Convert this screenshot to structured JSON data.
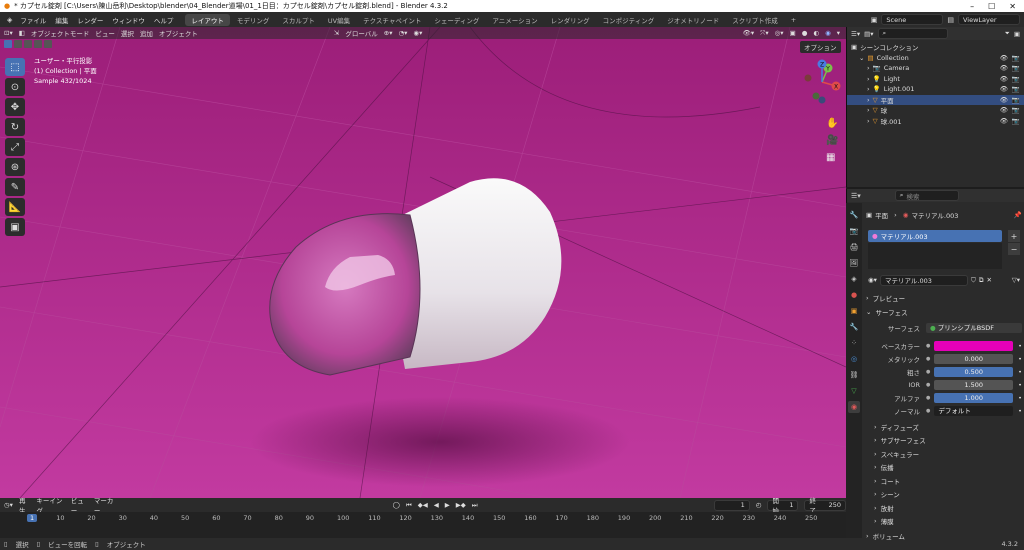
{
  "titlebar": {
    "text": "* カプセル錠剤 [C:\\Users\\陳山岳利\\Desktop\\blender\\04_Blender道場\\01_1日目：カプセル錠剤\\カプセル錠剤.blend] - Blender 4.3.2",
    "minimize": "–",
    "maximize": "☐",
    "close": "✕"
  },
  "menu": [
    "ファイル",
    "編集",
    "レンダー",
    "ウィンドウ",
    "ヘルプ"
  ],
  "workspaces": [
    "レイアウト",
    "モデリング",
    "スカルプト",
    "UV編集",
    "テクスチャペイント",
    "シェーディング",
    "アニメーション",
    "レンダリング",
    "コンポジティング",
    "ジオメトリノード",
    "スクリプト作成"
  ],
  "workspace_add": "+",
  "scene": "Scene",
  "viewlayer": "ViewLayer",
  "viewport": {
    "mode": "オブジェクトモード",
    "menus": [
      "ビュー",
      "選択",
      "追加",
      "オブジェクト"
    ],
    "orientation": "グローバル",
    "options": "オプション",
    "overlay_lines": [
      "ユーザー・平行投影",
      "(1) Collection | 平面",
      "Sample 432/1024"
    ],
    "gizmo": {
      "x": "X",
      "y": "Y",
      "z": "Z"
    }
  },
  "timeline": {
    "menus": [
      "再生",
      "キーイング",
      "ビュー",
      "マーカー"
    ],
    "current_frame": "1",
    "start_label": "開始",
    "start": "1",
    "end_label": "終了",
    "end": "250",
    "ticks": [
      "1",
      "10",
      "20",
      "30",
      "40",
      "50",
      "60",
      "70",
      "80",
      "90",
      "100",
      "110",
      "120",
      "130",
      "140",
      "150",
      "160",
      "170",
      "180",
      "190",
      "200",
      "210",
      "220",
      "230",
      "240",
      "250"
    ]
  },
  "statusbar": {
    "items": [
      "選択",
      "ビューを回転",
      "オブジェクト"
    ],
    "version": "4.3.2"
  },
  "outliner": {
    "title": "シーンコレクション",
    "rows": [
      {
        "label": "Collection",
        "indent": 1,
        "selected": false
      },
      {
        "label": "Camera",
        "indent": 2,
        "selected": false
      },
      {
        "label": "Light",
        "indent": 2,
        "selected": false
      },
      {
        "label": "Light.001",
        "indent": 2,
        "selected": false
      },
      {
        "label": "平面",
        "indent": 2,
        "selected": true
      },
      {
        "label": "球",
        "indent": 2,
        "selected": false
      },
      {
        "label": "球.001",
        "indent": 2,
        "selected": false
      }
    ]
  },
  "properties": {
    "search_placeholder": "検索",
    "breadcrumb_object": "平面",
    "breadcrumb_material": "マテリアル.003",
    "slot": "マテリアル.003",
    "material_name": "マテリアル.003",
    "sections": {
      "preview": "プレビュー",
      "surface": "サーフェス",
      "subsurface_list": [
        "ディフューズ",
        "サブサーフェス",
        "スペキュラー",
        "伝播",
        "コート",
        "シーン",
        "放射",
        "薄膜"
      ],
      "volume": "ボリューム"
    },
    "surface_label": "サーフェス",
    "surface_value": "プリンシプルBSDF",
    "fields": [
      {
        "label": "ベースカラー",
        "value": "",
        "kind": "color"
      },
      {
        "label": "メタリック",
        "value": "0.000",
        "kind": "normal"
      },
      {
        "label": "粗さ",
        "value": "0.500",
        "kind": "blue"
      },
      {
        "label": "IOR",
        "value": "1.500",
        "kind": "normal"
      },
      {
        "label": "アルファ",
        "value": "1.000",
        "kind": "blue"
      },
      {
        "label": "ノーマル",
        "value": "デフォルト",
        "kind": "dark"
      }
    ],
    "base_color": "#e600b8"
  }
}
